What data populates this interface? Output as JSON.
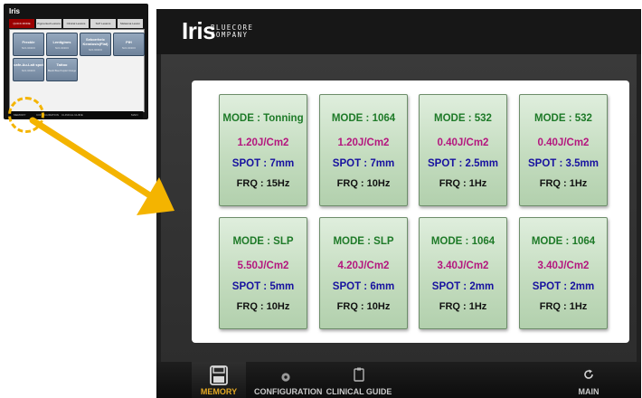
{
  "thumbnail": {
    "logo": "Iris",
    "tabs": [
      "QUICK MODE",
      "Pigmented Lesions",
      "Clinical Lesions",
      "SLP Lesions",
      "Melasma Lesion"
    ],
    "cards": [
      {
        "title": "Freckle",
        "sub": "Nd 1.6J/10.6"
      },
      {
        "title": "Lentigines",
        "sub": "Nd 1.6J/10.6"
      },
      {
        "title": "Seborrheic Keratosis(Flat)",
        "sub": "Nd 1.6J/10.6"
      },
      {
        "title": "PIH",
        "sub": "Nd 1.6J/10.6"
      },
      {
        "title": "cafe-Au-Lait spot",
        "sub": "Nd 1.6J/10.6"
      },
      {
        "title": "Tattoo",
        "sub": "Black/ Blue Purple/ Orange"
      }
    ],
    "footer": [
      "MEMORY",
      "CONFIGURATION",
      "CLINICAL GUIDE",
      "MAIN"
    ]
  },
  "header": {
    "logo": "Iris",
    "sub1": "BLUECORE",
    "sub2": "COMPANY"
  },
  "presets": [
    {
      "mode": "MODE : Tonning",
      "energy": "1.20J/Cm2",
      "spot": "SPOT : 7mm",
      "frq": "FRQ : 15Hz"
    },
    {
      "mode": "MODE : 1064",
      "energy": "1.20J/Cm2",
      "spot": "SPOT : 7mm",
      "frq": "FRQ : 10Hz"
    },
    {
      "mode": "MODE : 532",
      "energy": "0.40J/Cm2",
      "spot": "SPOT : 2.5mm",
      "frq": "FRQ : 1Hz"
    },
    {
      "mode": "MODE : 532",
      "energy": "0.40J/Cm2",
      "spot": "SPOT : 3.5mm",
      "frq": "FRQ : 1Hz"
    },
    {
      "mode": "MODE : SLP",
      "energy": "5.50J/Cm2",
      "spot": "SPOT : 5mm",
      "frq": "FRQ : 10Hz"
    },
    {
      "mode": "MODE : SLP",
      "energy": "4.20J/Cm2",
      "spot": "SPOT : 6mm",
      "frq": "FRQ : 10Hz"
    },
    {
      "mode": "MODE : 1064",
      "energy": "3.40J/Cm2",
      "spot": "SPOT : 2mm",
      "frq": "FRQ : 1Hz"
    },
    {
      "mode": "MODE : 1064",
      "energy": "3.40J/Cm2",
      "spot": "SPOT : 2mm",
      "frq": "FRQ : 1Hz"
    }
  ],
  "nav": {
    "memory": "MEMORY",
    "configuration": "CONFIGURATION",
    "clinical_guide": "CLINICAL GUIDE",
    "main": "MAIN"
  },
  "colors": {
    "mode": "#1e7a28",
    "energy": "#b4167e",
    "spot": "#17119f",
    "accent": "#e4a823",
    "arrow": "#f4b400"
  },
  "icons": {
    "memory": "floppy-disk-icon",
    "configuration": "gear-icon",
    "clinical_guide": "clipboard-icon",
    "main": "refresh-icon"
  }
}
